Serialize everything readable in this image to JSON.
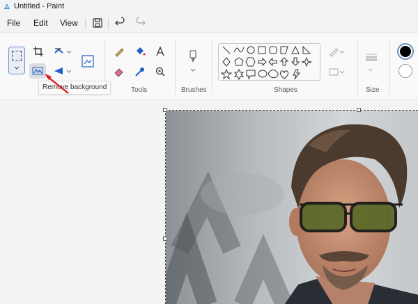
{
  "window": {
    "title": "Untitled - Paint"
  },
  "menu": {
    "file": "File",
    "edit": "Edit",
    "view": "View"
  },
  "ribbon": {
    "groups": {
      "tools": "Tools",
      "brushes": "Brushes",
      "shapes": "Shapes",
      "size": "Size"
    },
    "tooltip": "Remove background"
  },
  "colors": {
    "primary": "#000000",
    "secondary": "#ffffff",
    "accent": "#6c8fc7",
    "arrow": "#d62020"
  }
}
